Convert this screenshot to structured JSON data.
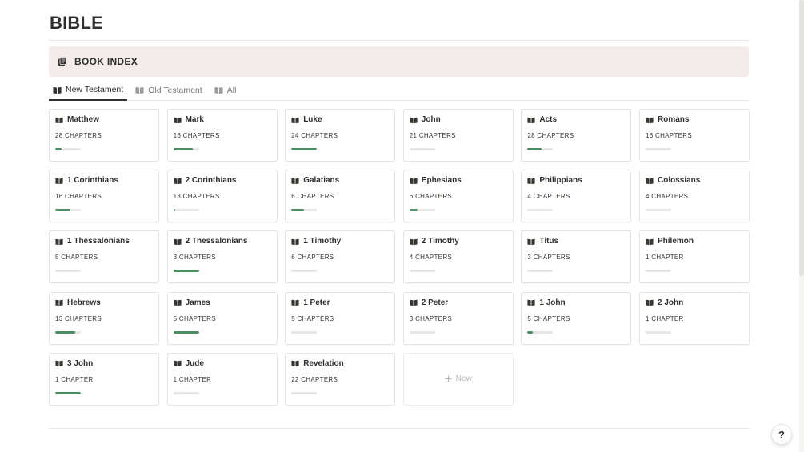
{
  "page": {
    "title": "BIBLE"
  },
  "callout": {
    "title": "BOOK INDEX",
    "icon": "document-stack-icon"
  },
  "tabs": [
    {
      "label": "New Testament",
      "active": true,
      "icon": "book-icon"
    },
    {
      "label": "Old Testament",
      "active": false,
      "icon": "book-icon"
    },
    {
      "label": "All",
      "active": false,
      "icon": "book-icon"
    }
  ],
  "books": [
    {
      "name": "Matthew",
      "chapters": "28 CHAPTERS",
      "progress": 0.25
    },
    {
      "name": "Mark",
      "chapters": "16 CHAPTERS",
      "progress": 0.75
    },
    {
      "name": "Luke",
      "chapters": "24 CHAPTERS",
      "progress": 1.0
    },
    {
      "name": "John",
      "chapters": "21 CHAPTERS",
      "progress": 0.0
    },
    {
      "name": "Acts",
      "chapters": "28 CHAPTERS",
      "progress": 0.55
    },
    {
      "name": "Romans",
      "chapters": "16 CHAPTERS",
      "progress": 0.0
    },
    {
      "name": "1 Corinthians",
      "chapters": "16 CHAPTERS",
      "progress": 0.6
    },
    {
      "name": "2 Corinthians",
      "chapters": "13 CHAPTERS",
      "progress": 0.08
    },
    {
      "name": "Galatians",
      "chapters": "6 CHAPTERS",
      "progress": 0.5
    },
    {
      "name": "Ephesians",
      "chapters": "6 CHAPTERS",
      "progress": 0.33
    },
    {
      "name": "Philippians",
      "chapters": "4 CHAPTERS",
      "progress": 0.0
    },
    {
      "name": "Colossians",
      "chapters": "4 CHAPTERS",
      "progress": 0.0
    },
    {
      "name": "1 Thessalonians",
      "chapters": "5 CHAPTERS",
      "progress": 0.0
    },
    {
      "name": "2 Thessalonians",
      "chapters": "3 CHAPTERS",
      "progress": 1.0
    },
    {
      "name": "1 Timothy",
      "chapters": "6 CHAPTERS",
      "progress": 0.0
    },
    {
      "name": "2 Timothy",
      "chapters": "4 CHAPTERS",
      "progress": 0.0
    },
    {
      "name": "Titus",
      "chapters": "3 CHAPTERS",
      "progress": 0.0
    },
    {
      "name": "Philemon",
      "chapters": "1 CHAPTER",
      "progress": 0.0
    },
    {
      "name": "Hebrews",
      "chapters": "13 CHAPTERS",
      "progress": 0.77
    },
    {
      "name": "James",
      "chapters": "5 CHAPTERS",
      "progress": 1.0
    },
    {
      "name": "1 Peter",
      "chapters": "5 CHAPTERS",
      "progress": 0.0
    },
    {
      "name": "2 Peter",
      "chapters": "3 CHAPTERS",
      "progress": 0.0
    },
    {
      "name": "1 John",
      "chapters": "5 CHAPTERS",
      "progress": 0.2
    },
    {
      "name": "2 John",
      "chapters": "1 CHAPTER",
      "progress": 0.0
    },
    {
      "name": "3 John",
      "chapters": "1 CHAPTER",
      "progress": 1.0
    },
    {
      "name": "Jude",
      "chapters": "1 CHAPTER",
      "progress": 0.0
    },
    {
      "name": "Revelation",
      "chapters": "22 CHAPTERS",
      "progress": 0.0
    }
  ],
  "new_card": {
    "label": "New",
    "icon": "plus-icon"
  },
  "help": {
    "label": "?"
  },
  "colors": {
    "progress": "#4b8c63",
    "track": "#e6e6e4",
    "callout_bg": "#f4ecea"
  }
}
